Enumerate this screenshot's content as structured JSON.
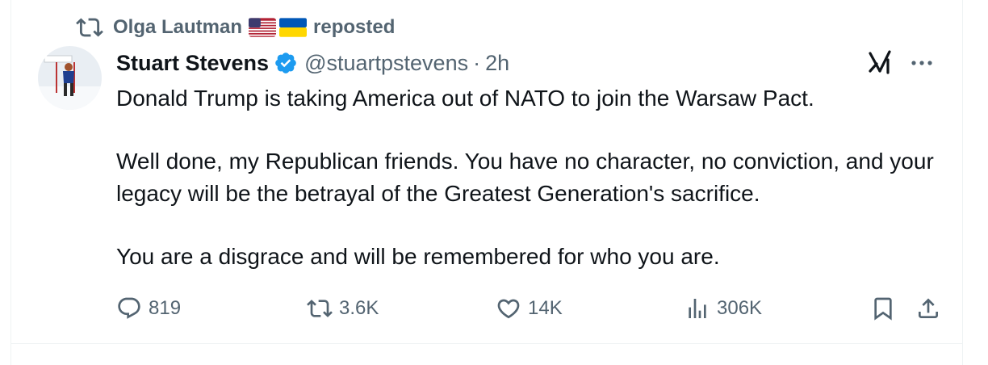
{
  "social_context": {
    "reposter": "Olga Lautman",
    "action": "reposted"
  },
  "tweet": {
    "display_name": "Stuart Stevens",
    "handle": "@stuartpstevens",
    "separator": "·",
    "timestamp": "2h",
    "paragraphs": [
      "Donald Trump is taking America out of NATO to join the Warsaw Pact.",
      "Well done, my Republican friends. You have no character, no conviction, and your legacy will be the betrayal of the Greatest Generation's sacrifice.",
      "You are a disgrace and will be remembered for who you are."
    ]
  },
  "metrics": {
    "replies": "819",
    "reposts": "3.6K",
    "likes": "14K",
    "views": "306K"
  },
  "icons": {
    "repost": "repost-icon",
    "verified": "verified-badge-icon",
    "grok": "grok-icon",
    "more": "more-icon",
    "reply": "reply-icon",
    "like": "heart-icon",
    "views": "views-icon",
    "bookmark": "bookmark-icon",
    "share": "share-icon"
  },
  "colors": {
    "text": "#0f1419",
    "secondary": "#536471",
    "verified": "#1d9bf0",
    "border": "#eff3f4"
  }
}
